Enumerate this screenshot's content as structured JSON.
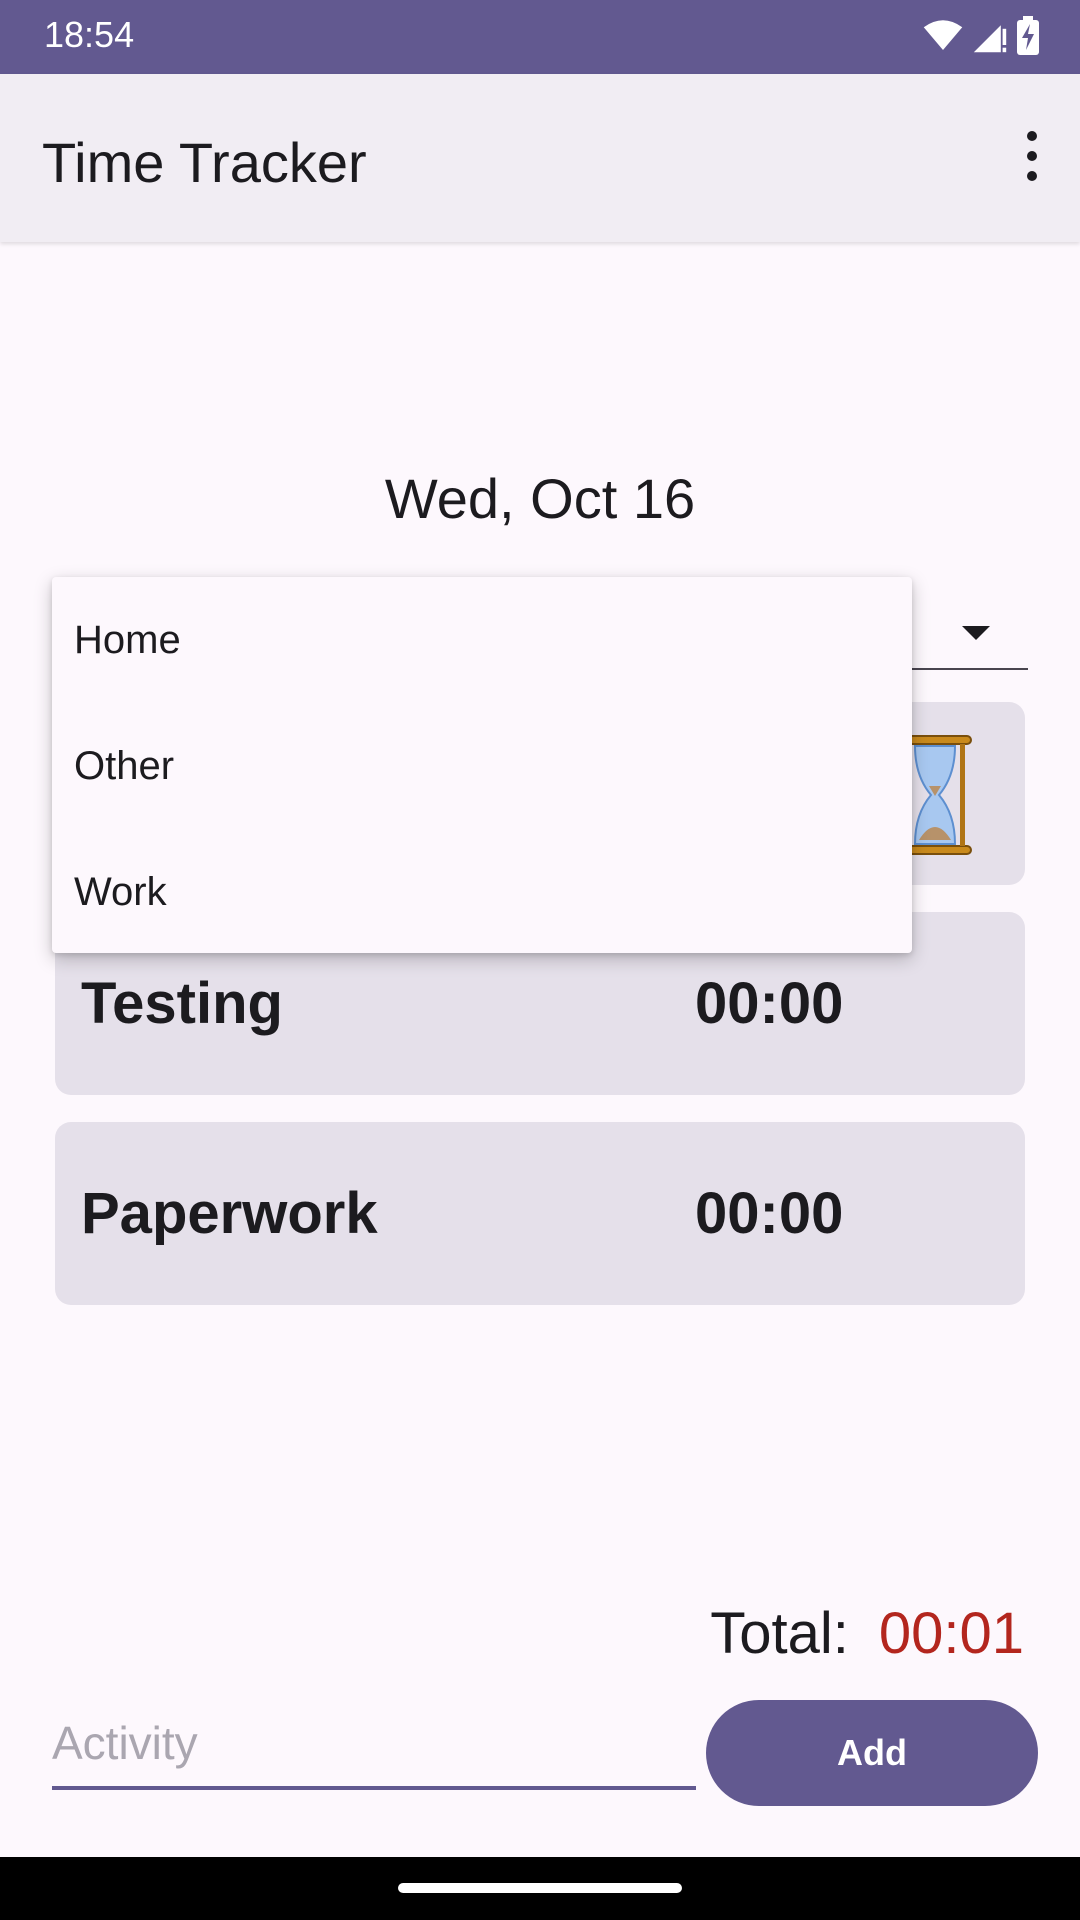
{
  "status_bar": {
    "time": "18:54"
  },
  "app_bar": {
    "title": "Time Tracker",
    "overflow_icon": "more-vert-icon"
  },
  "date": "Wed, Oct 16",
  "category_spinner": {
    "options": [
      "Home",
      "Other",
      "Work"
    ]
  },
  "activities": [
    {
      "name": "",
      "time": "",
      "icon": "hourglass-icon"
    },
    {
      "name": "Testing",
      "time": "00:00"
    },
    {
      "name": "Paperwork",
      "time": "00:00"
    }
  ],
  "total": {
    "label": "Total:",
    "value": "00:01",
    "value_color": "#b3261e"
  },
  "input": {
    "placeholder": "Activity"
  },
  "add_button": {
    "label": "Add"
  },
  "colors": {
    "primary": "#625990",
    "surface": "#fdf8fd",
    "card": "#e5e0ea"
  }
}
